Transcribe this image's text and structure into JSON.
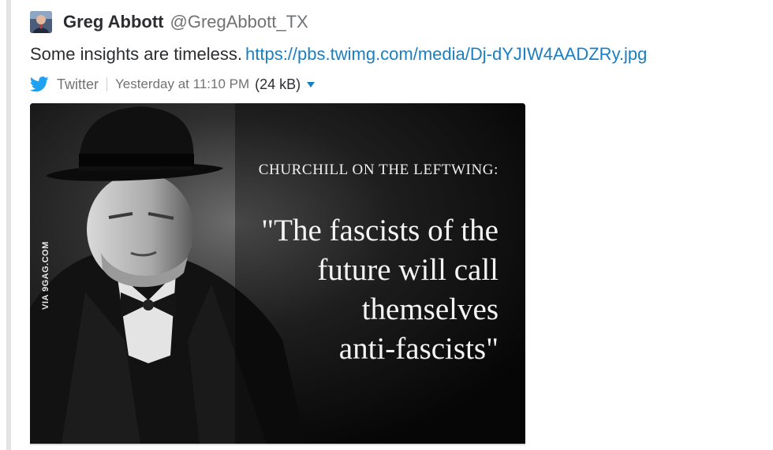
{
  "message": {
    "author_name": "Greg Abbott",
    "author_handle": "@GregAbbott_TX",
    "text": "Some insights are timeless.",
    "link": "https://pbs.twimg.com/media/Dj-dYJIW4AADZRy.jpg"
  },
  "attachment": {
    "source": "Twitter",
    "timestamp": "Yesterday at 11:10 PM",
    "size": "(24 kB)"
  },
  "image": {
    "watermark": "VIA 9GAG.COM",
    "heading": "CHURCHILL ON THE LEFTWING:",
    "quote_lines": [
      "\"The fascists of the",
      "future will call",
      "themselves",
      "anti-fascists\""
    ]
  },
  "colors": {
    "link": "#1a7fc1",
    "twitter_brand": "#1da1f2",
    "text": "#2c2d30",
    "muted": "#717274"
  },
  "icons": {
    "source_icon": "twitter-bird-icon",
    "menu_icon": "caret-down-icon"
  }
}
